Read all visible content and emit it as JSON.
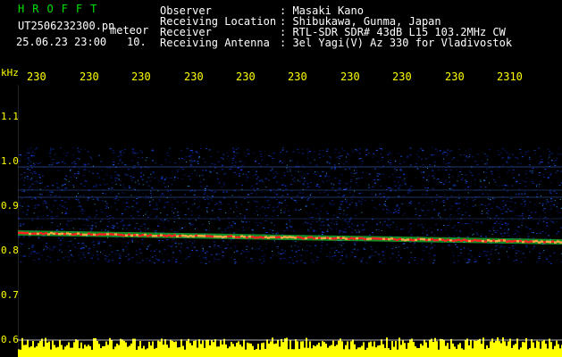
{
  "header": {
    "title": "HROFFT",
    "file_name": "UT2506232300.pn",
    "tag": "meteor",
    "datetime": "25.06.23 23:00",
    "count": "10."
  },
  "info": {
    "labels": [
      "Observer",
      "Receiving Location",
      "Receiver",
      "Receiving Antenna"
    ],
    "values": [
      ": Masaki Kano",
      ": Shibukawa, Gunma, Japan",
      ": RTL-SDR SDR# 43dB L15 103.2MHz CW",
      ": 3el Yagi(V) Az 330 for Vladivostok"
    ]
  },
  "axes": {
    "unit": "kHz",
    "time_ticks": [
      "230",
      "230",
      "230",
      "230",
      "230",
      "230",
      "230",
      "230",
      "230",
      "2310"
    ],
    "freq_ticks": [
      "1.1",
      "1.0",
      "0.9",
      "0.8",
      "0.7",
      "0.6"
    ]
  },
  "colors": {
    "background": "#000000",
    "text": "#ffffff",
    "title": "#00e000",
    "axis_labels": "#ffff00",
    "noise_floor": "#ffff00",
    "signal_trace": "#ff2020",
    "signal_halo": "#20ff40",
    "spectrum_noise": "#1840ff"
  }
}
